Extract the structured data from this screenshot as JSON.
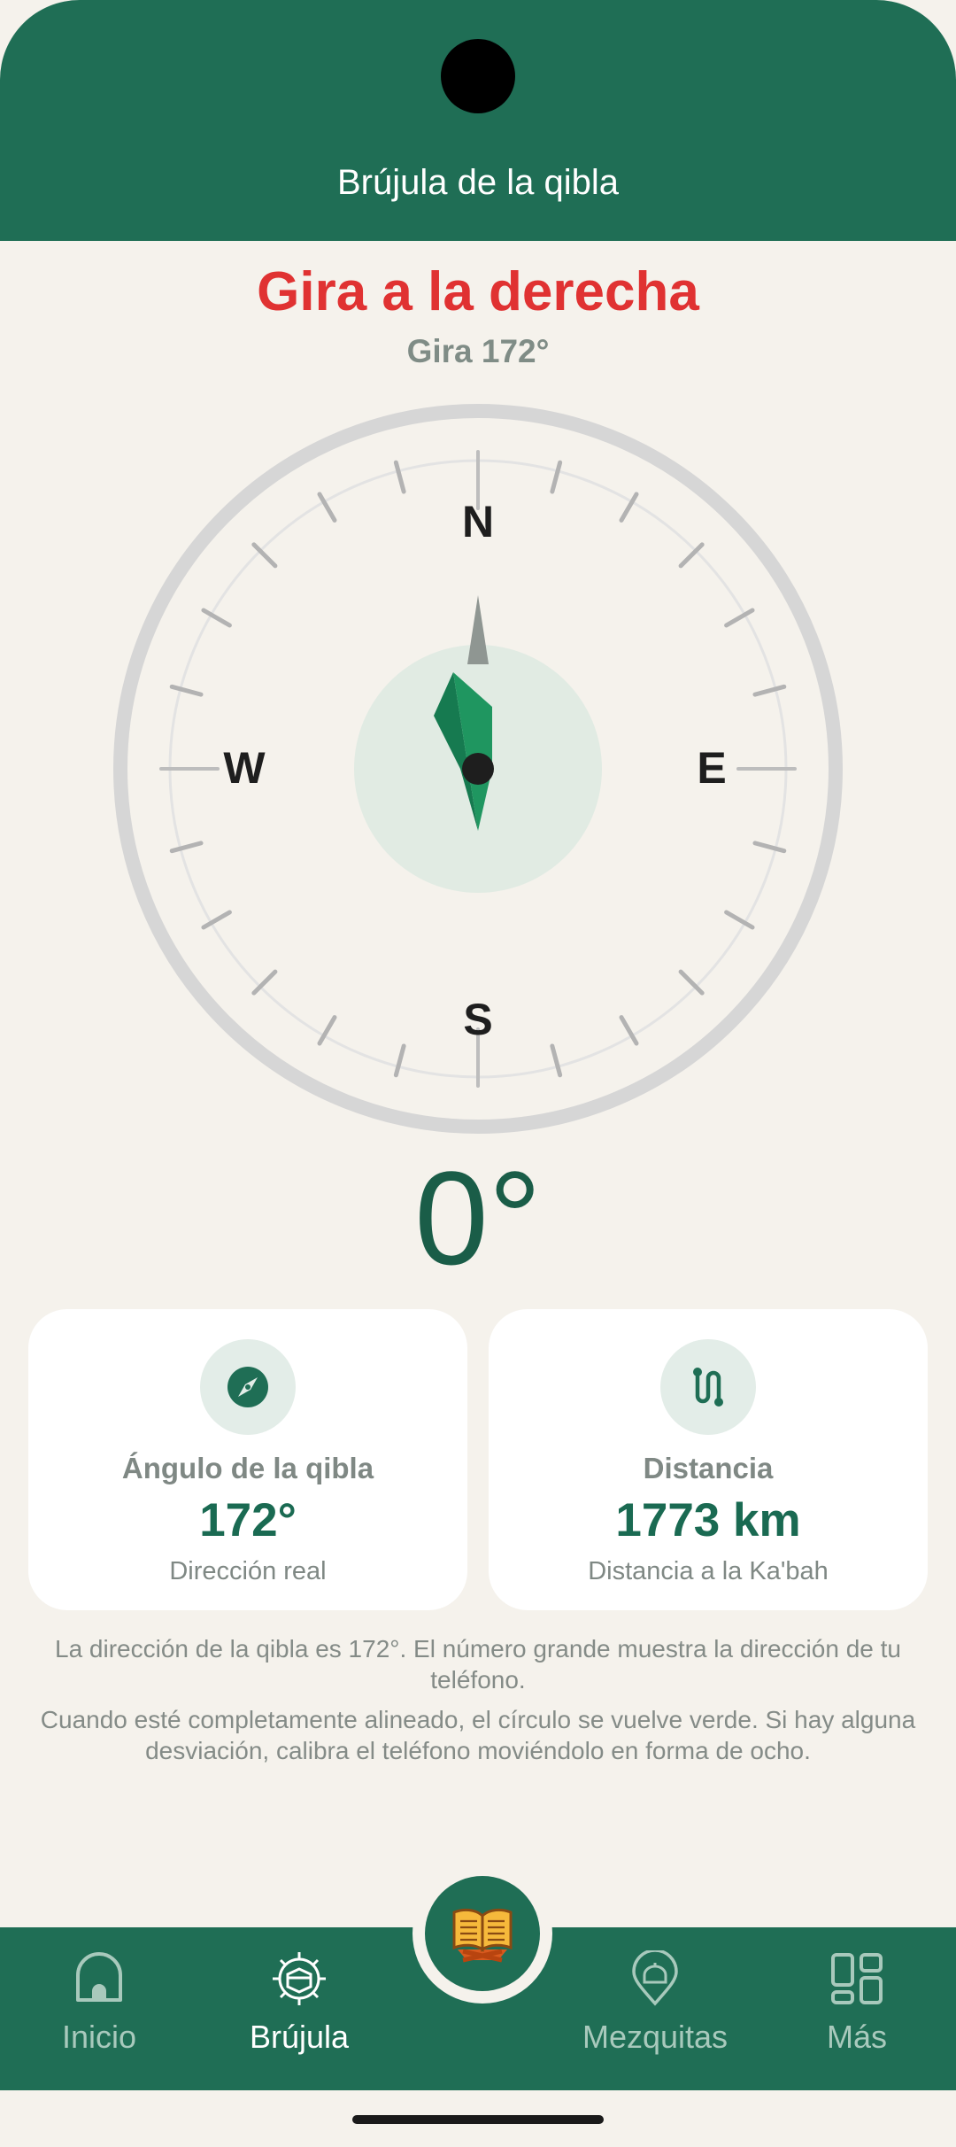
{
  "header": {
    "title": "Brújula de la qibla"
  },
  "status": {
    "turn_title": "Gira a la derecha",
    "turn_subtitle": "Gira 172°"
  },
  "compass": {
    "north": "N",
    "east": "E",
    "south": "S",
    "west": "W",
    "needle_deg": 172
  },
  "heading": {
    "value": "0°"
  },
  "cards": {
    "qibla": {
      "icon": "compass-icon",
      "label": "Ángulo de la qibla",
      "value": "172°",
      "sub": "Dirección real"
    },
    "distance": {
      "icon": "route-icon",
      "label": "Distancia",
      "value": "1773 km",
      "sub": "Distancia a la Ka'bah"
    }
  },
  "info": {
    "line1": "La dirección de la qibla es 172°. El número grande muestra la dirección de tu teléfono.",
    "line2": "Cuando esté completamente alineado, el círculo se vuelve verde. Si hay alguna desviación, calibra el teléfono moviéndolo en forma de ocho."
  },
  "nav": {
    "items": [
      {
        "label": "Inicio",
        "icon": "home-icon"
      },
      {
        "label": "Brújula",
        "icon": "kaaba-compass-icon",
        "active": true
      },
      {
        "label": "",
        "icon": "quran-book-icon"
      },
      {
        "label": "Mezquitas",
        "icon": "mosque-pin-icon"
      },
      {
        "label": "Más",
        "icon": "grid-icon"
      }
    ]
  },
  "colors": {
    "primary": "#1f6e55",
    "alert": "#e03232",
    "background": "#f5f2ec",
    "needle": "#1f9660"
  }
}
